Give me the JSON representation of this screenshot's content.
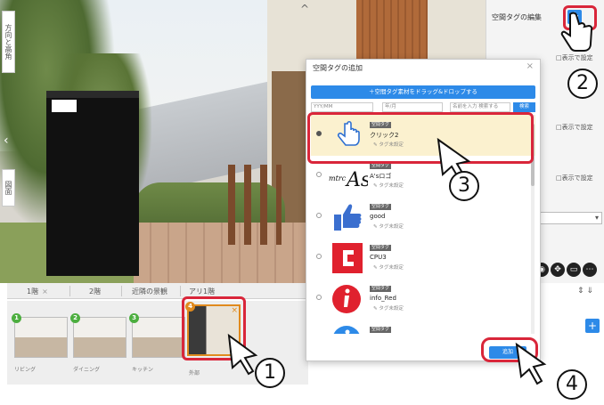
{
  "viewport": {
    "left_tools": [
      "方向と高角",
      "図面"
    ],
    "top_chevron": "^"
  },
  "right_panel": {
    "title": "空間タグの編集",
    "add_button": "+",
    "options": [
      "□表示で設定",
      "□表示で設定",
      "□表示で設定"
    ]
  },
  "bottom_bar": {
    "tabs": [
      {
        "label": "1階"
      },
      {
        "label": "2階"
      },
      {
        "label": "近隣の景観"
      },
      {
        "label": "アリ1階"
      }
    ],
    "tab_close": "×",
    "thumbnails": [
      {
        "badge": "1",
        "label": "リビング"
      },
      {
        "badge": "2",
        "label": "ダイニング"
      },
      {
        "badge": "3",
        "label": "キッチン"
      },
      {
        "badge": "4",
        "label": "外部"
      }
    ],
    "add_button": "+"
  },
  "dialog": {
    "title": "空間タグの追加",
    "close": "×",
    "import_button": "＋空間タグ素材をドラッグ&ドロップする",
    "filter": {
      "from_placeholder": "YYY/MM",
      "to_placeholder": "年/月",
      "keyword_placeholder": "名前を入力 検索する",
      "search_button": "検索"
    },
    "tags": [
      {
        "badge": "空間タグ",
        "name": "クリック2",
        "sub": "✎ タグ未設定",
        "icon": "pointer-hand-icon",
        "selected": true
      },
      {
        "badge": "空間タグ",
        "name": "A'sロゴ",
        "sub": "✎ タグ未設定",
        "icon": "as-logo-icon",
        "selected": false
      },
      {
        "badge": "空間タグ",
        "name": "good",
        "sub": "✎ タグ未設定",
        "icon": "thumbs-up-icon",
        "selected": false
      },
      {
        "badge": "空間タグ",
        "name": "CPU3",
        "sub": "✎ タグ未設定",
        "icon": "cpu-logo-icon",
        "selected": false
      },
      {
        "badge": "空間タグ",
        "name": "info_Red",
        "sub": "✎ タグ未設定",
        "icon": "info-red-icon",
        "selected": false
      },
      {
        "badge": "空間タグ",
        "name": "",
        "sub": "",
        "icon": "info-blue-icon",
        "selected": false
      }
    ],
    "ok_button": "追加"
  },
  "callouts": [
    "1",
    "2",
    "3",
    "4"
  ],
  "colors": {
    "accent": "#2d8ae8",
    "annotation_red": "#d9263a",
    "selected_row": "#fbf1cf",
    "active_thumb": "#e08a1e"
  }
}
